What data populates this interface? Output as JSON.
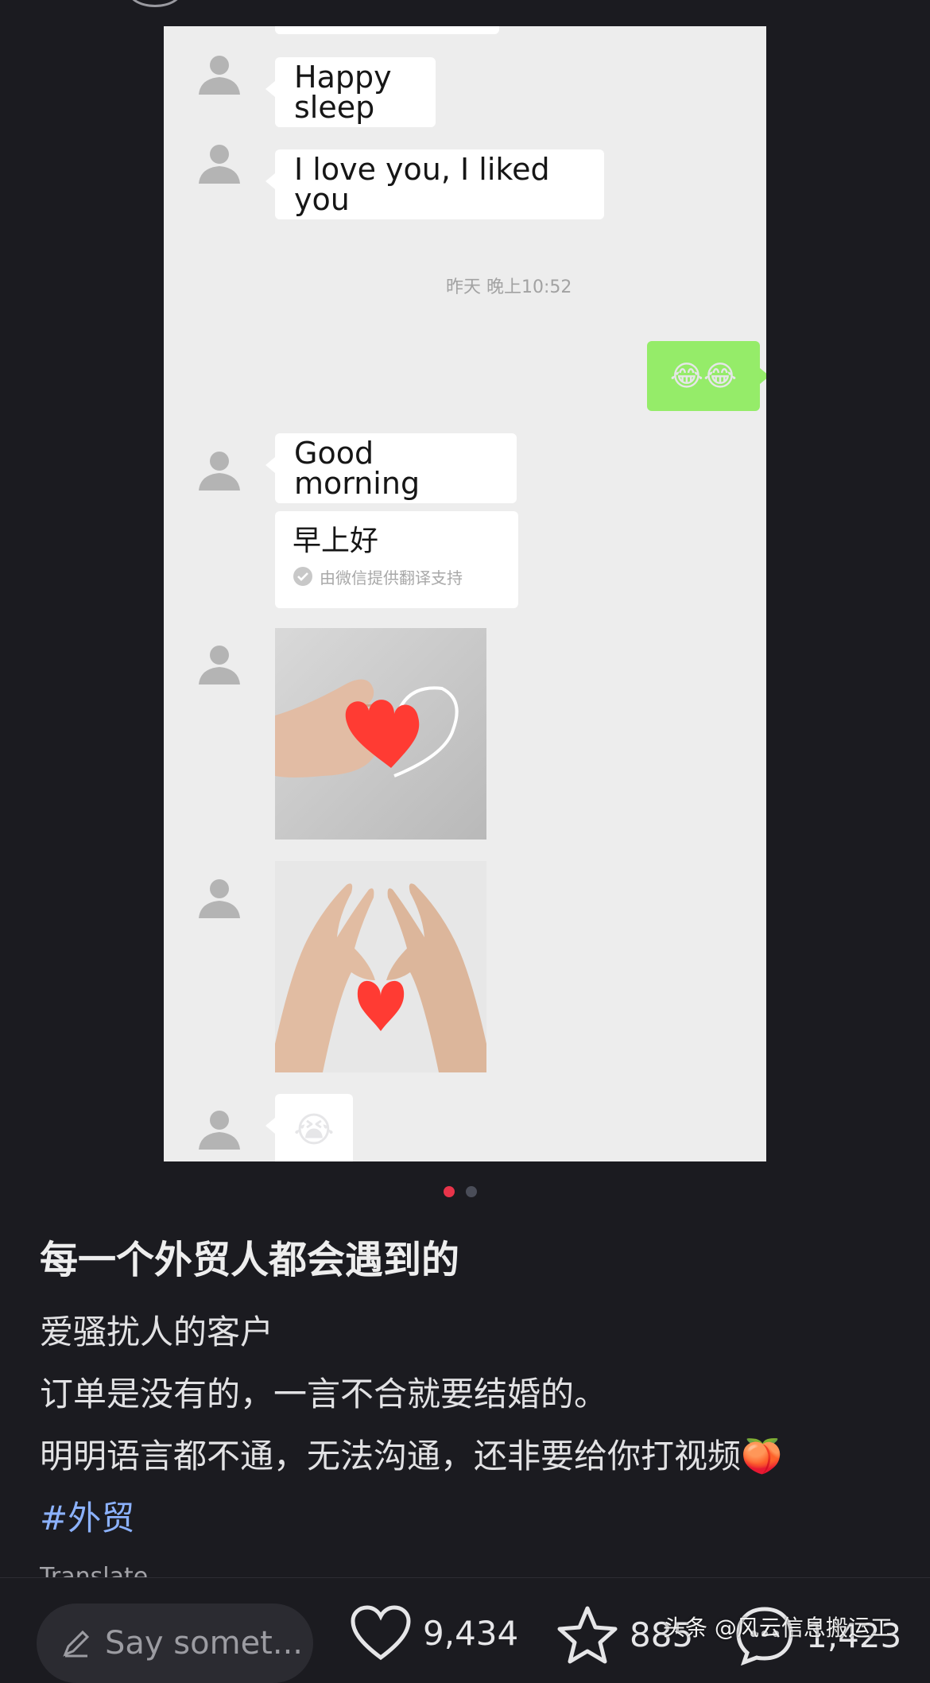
{
  "chat": {
    "messages_before": [
      {
        "text": "Happy sleep"
      },
      {
        "text": "I love you, I liked you"
      }
    ],
    "timestamp": "昨天 晚上10:52",
    "sent_emoji": "😂😂",
    "good_morning": "Good morning",
    "translation": {
      "text": "早上好",
      "note": "由微信提供翻译支持"
    },
    "last_emoji": "😭"
  },
  "pager": {
    "count": 2,
    "active": 0
  },
  "post": {
    "title": "每一个外贸人都会遇到的",
    "lines": [
      "爱骚扰人的客户",
      "订单是没有的，一言不合就要结婚的。",
      "明明语言都不通，无法沟通，还非要给你打视频🍑"
    ],
    "hashtag": "#外贸",
    "translate": "Translate"
  },
  "bottom_bar": {
    "comment_placeholder": "Say somet...",
    "likes": "9,434",
    "favorites": "885",
    "comments": "1,423"
  },
  "watermark": "头条 @风云信息搬运工",
  "colors": {
    "background": "#1b1b20",
    "chat_bg": "#ededed",
    "sent_bubble": "#95ec69",
    "dot_active": "#e8344a",
    "hashtag": "#8cb2ff"
  },
  "icons": {
    "avatar": "default-avatar-icon",
    "check": "check-circle-icon",
    "comment_pen": "pen-icon",
    "like": "heart-icon",
    "favorite": "star-icon",
    "comment": "comment-bubble-icon"
  }
}
